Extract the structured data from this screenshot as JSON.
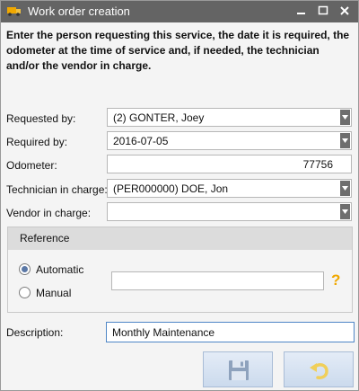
{
  "window": {
    "title": "Work order creation"
  },
  "instructions": "Enter the person requesting this service, the date it is required, the odometer at the time of service and, if needed, the technician and/or the vendor in charge.",
  "form": {
    "requested_by": {
      "label": "Requested by:",
      "value": "(2)  GONTER, Joey"
    },
    "required_by": {
      "label": "Required by:",
      "value": "2016-07-05"
    },
    "odometer": {
      "label": "Odometer:",
      "value": "77756"
    },
    "technician": {
      "label": "Technician in charge:",
      "value": "(PER000000)  DOE, Jon"
    },
    "vendor": {
      "label": "Vendor in charge:",
      "value": ""
    }
  },
  "reference": {
    "title": "Reference",
    "options": [
      {
        "label": "Automatic",
        "selected": true
      },
      {
        "label": "Manual",
        "selected": false
      }
    ],
    "value": "",
    "help_glyph": "?"
  },
  "description": {
    "label": "Description:",
    "value": "Monthly Maintenance"
  },
  "icons": {
    "app": "truck-icon",
    "save": "save-icon",
    "undo": "undo-icon"
  },
  "colors": {
    "titlebar": "#646464",
    "help": "#f0a800",
    "radio_selected": "#5b78a6",
    "focus_border": "#4f86c6"
  }
}
